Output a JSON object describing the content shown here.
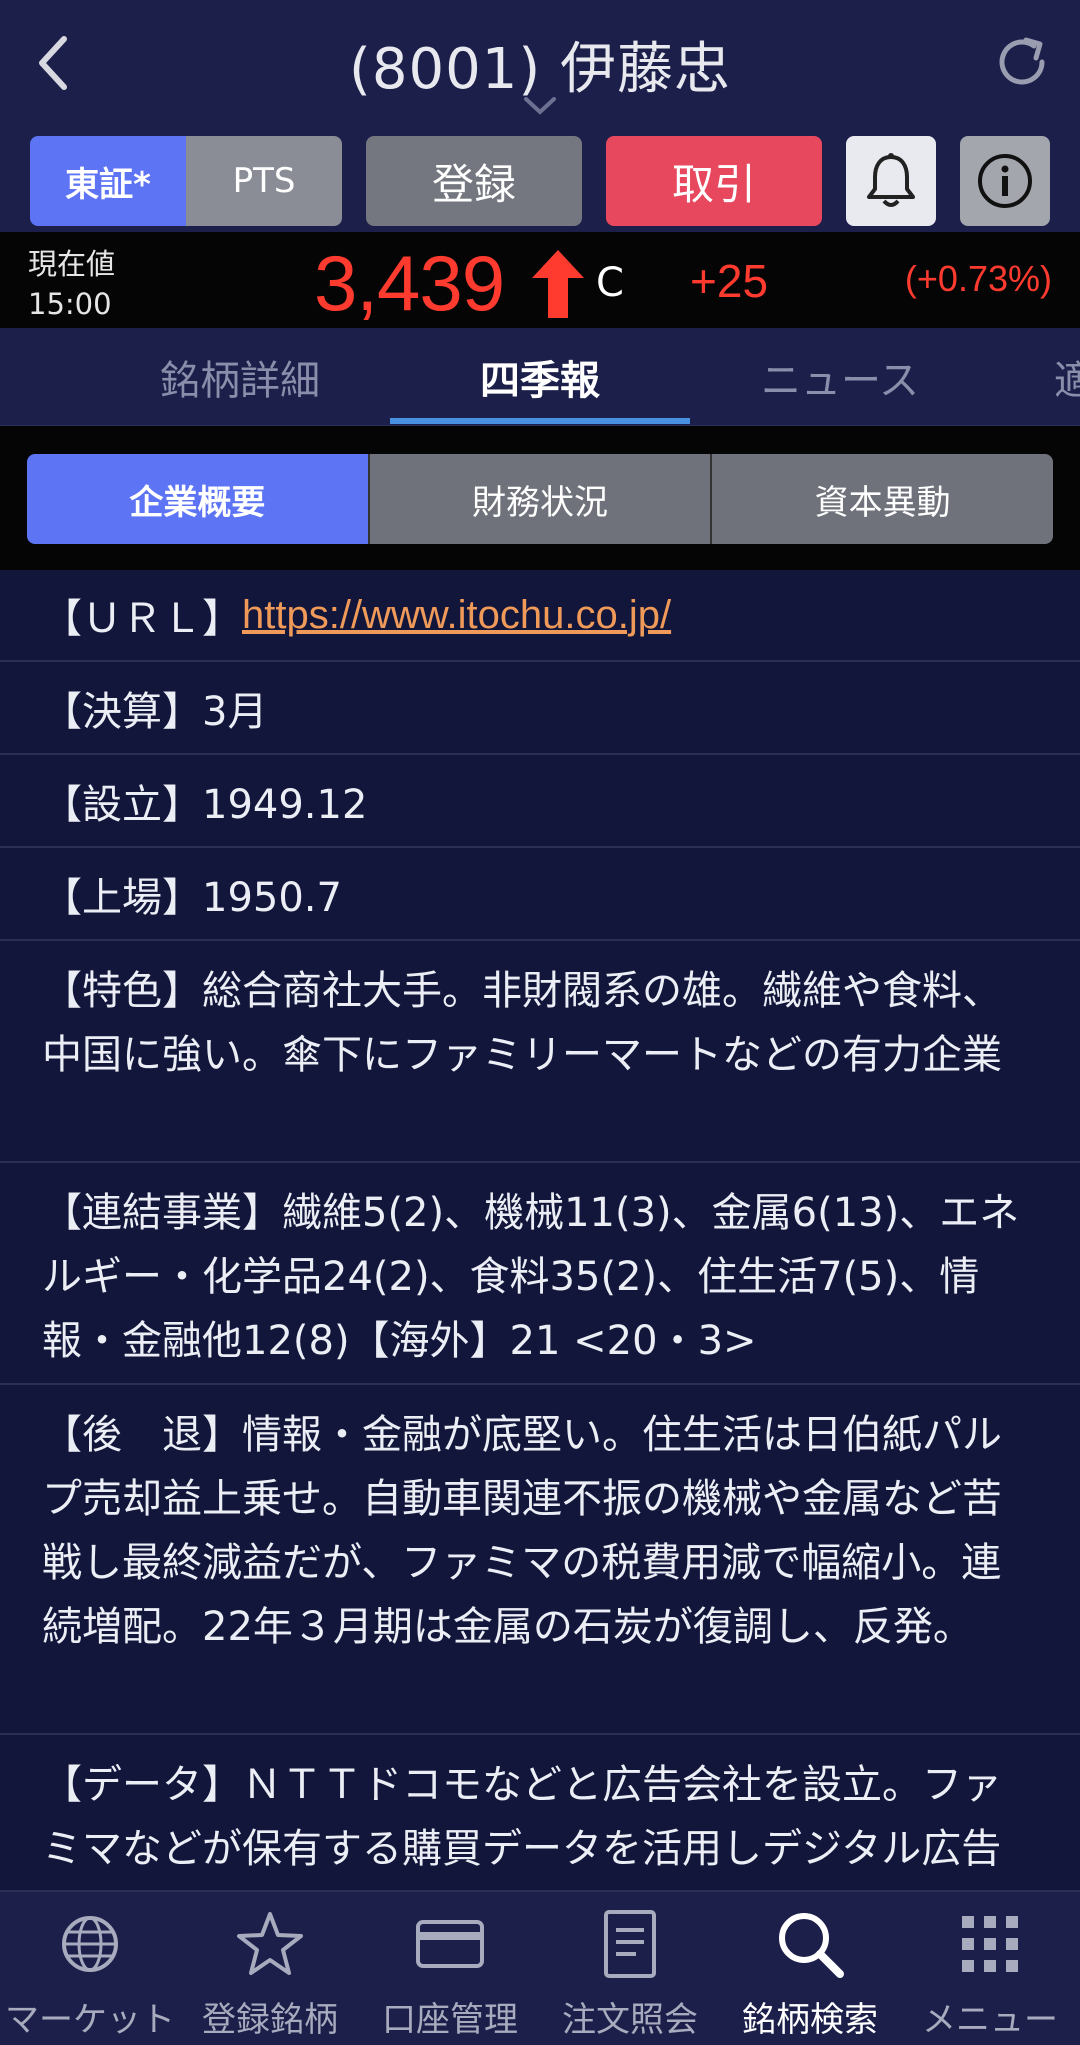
{
  "header": {
    "title": "(8001) 伊藤忠"
  },
  "actions": {
    "market_primary": "東証*",
    "market_secondary": "PTS",
    "register_label": "登録",
    "trade_label": "取引"
  },
  "price": {
    "label": "現在値",
    "time": "15:00",
    "value": "3,439",
    "flag": "C",
    "change": "+25",
    "change_pct": "(+0.73%)",
    "up_color": "#ff3b2f"
  },
  "tabs": {
    "left_partial": "",
    "items": [
      "銘柄詳細",
      "四季報",
      "ニュース"
    ],
    "right_partial": "適",
    "active": "四季報"
  },
  "subtabs": {
    "items": [
      "企業概要",
      "財務状況",
      "資本異動"
    ],
    "active": "企業概要"
  },
  "company": {
    "url_key": "【ＵＲＬ】",
    "url": "https://www.itochu.co.jp/",
    "fiscal": "【決算】3月",
    "founded": "【設立】1949.12",
    "listed": "【上場】1950.7",
    "feature": "【特色】総合商社大手。非財閥系の雄。繊維や食料、中国に強い。傘下にファミリーマートなどの有力企業",
    "segments": "【連結事業】繊維5(2)、機械11(3)、金属6(13)、エネルギー・化学品24(2)、食料35(2)、住生活7(5)、情報・金融他12(8)【海外】21 <20・3>",
    "outlook": "【後　退】情報・金融が底堅い。住生活は日伯紙パルプ売却益上乗せ。自動車関連不振の機械や金属など苦戦し最終減益だが、ファミマの税費用減で幅縮小。連続増配。22年３月期は金属の石炭が復調し、反発。",
    "data": "【データ】ＮＴＴドコモなどと広告会社を設立。ファミマなどが保有する購買データを活用しデジタル広告配信。環境事業強化へ、リサイクル…業系事業者"
  },
  "nav": {
    "items": [
      "マーケット",
      "登録銘柄",
      "口座管理",
      "注文照会",
      "銘柄検索",
      "メニュー"
    ],
    "active": "銘柄検索"
  },
  "colors": {
    "accent": "#5d74f5",
    "trade": "#e8485e",
    "link": "#f09a5a",
    "background": "#12163a"
  }
}
